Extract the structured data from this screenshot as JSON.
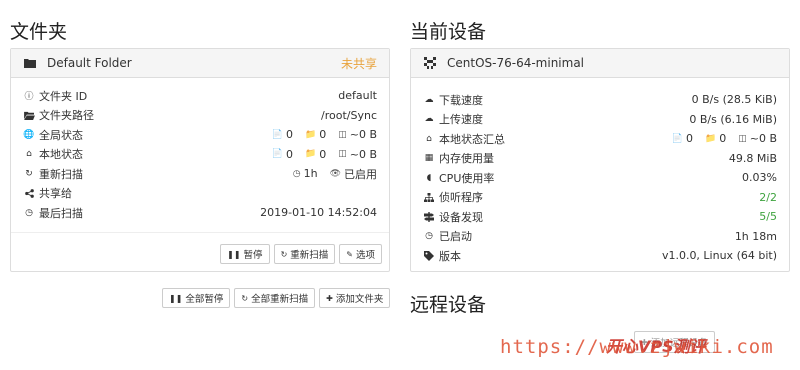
{
  "folders": {
    "title": "文件夹",
    "folder": {
      "name": "Default Folder",
      "status": "未共享",
      "rows": [
        {
          "label": "文件夹 ID",
          "value": "default"
        },
        {
          "label": "文件夹路径",
          "value": "/root/Sync"
        },
        {
          "label": "全局状态",
          "files": "0",
          "dirs": "0",
          "size": "~0 B"
        },
        {
          "label": "本地状态",
          "files": "0",
          "dirs": "0",
          "size": "~0 B"
        },
        {
          "label": "重新扫描",
          "interval": "1h",
          "enabled": "已启用"
        },
        {
          "label": "共享给",
          "value": ""
        },
        {
          "label": "最后扫描",
          "value": "2019-01-10 14:52:04"
        }
      ],
      "buttons": {
        "pause": "暂停",
        "rescan": "重新扫描",
        "options": "选项"
      }
    },
    "actions": {
      "pause_all": "全部暂停",
      "rescan_all": "全部重新扫描",
      "add_folder": "添加文件夹"
    }
  },
  "device": {
    "title": "当前设备",
    "name": "CentOS-76-64-minimal",
    "rows": [
      {
        "label": "下载速度",
        "value": "0 B/s (28.5 KiB)"
      },
      {
        "label": "上传速度",
        "value": "0 B/s (6.16 MiB)"
      },
      {
        "label": "本地状态汇总",
        "files": "0",
        "dirs": "0",
        "size": "~0 B"
      },
      {
        "label": "内存使用量",
        "value": "49.8 MiB"
      },
      {
        "label": "CPU使用率",
        "value": "0.03%"
      },
      {
        "label": "侦听程序",
        "value": "2/2"
      },
      {
        "label": "设备发现",
        "value": "5/5"
      },
      {
        "label": "已启动",
        "value": "1h 18m"
      },
      {
        "label": "版本",
        "value": "v1.0.0, Linux (64 bit)"
      }
    ]
  },
  "remote": {
    "title": "远程设备",
    "add_device_partial": "添加远程设备"
  },
  "watermark": {
    "url": "https://www.zjwiki.com",
    "brand": "开心VPS测评"
  },
  "colors": {
    "accent_unshared": "#e8a33d",
    "ok_green": "#3fa33f"
  }
}
